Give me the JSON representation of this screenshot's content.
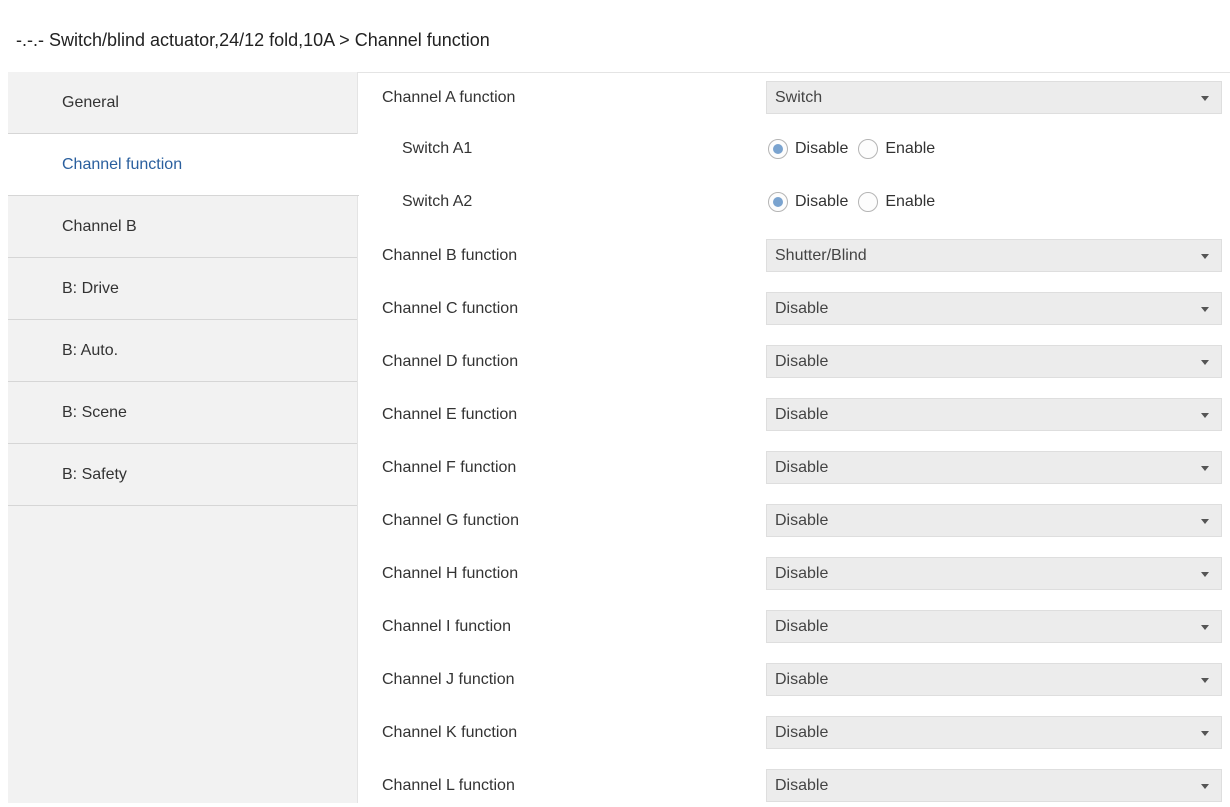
{
  "window": {
    "title": "-.-.- Switch/blind actuator,24/12 fold,10A > Channel function"
  },
  "sidebar": {
    "items": [
      {
        "label": "General",
        "active": false
      },
      {
        "label": "Channel function",
        "active": true
      },
      {
        "label": "Channel B",
        "active": false
      },
      {
        "label": "B: Drive",
        "active": false
      },
      {
        "label": "B: Auto.",
        "active": false
      },
      {
        "label": "B: Scene",
        "active": false
      },
      {
        "label": "B: Safety",
        "active": false
      }
    ]
  },
  "colors": {
    "active_nav_text": "#2a5f9e",
    "sidebar_bg": "#f2f2f2",
    "dropdown_bg": "#ececec",
    "radio_checked": "#7aa3cf"
  },
  "params": {
    "channel_a": {
      "label": "Channel A function",
      "value": "Switch"
    },
    "switch_a1": {
      "label": "Switch A1",
      "options": [
        "Disable",
        "Enable"
      ],
      "selected": "Disable"
    },
    "switch_a2": {
      "label": "Switch A2",
      "options": [
        "Disable",
        "Enable"
      ],
      "selected": "Disable"
    },
    "channel_b": {
      "label": "Channel B function",
      "value": "Shutter/Blind"
    },
    "channel_c": {
      "label": "Channel C function",
      "value": "Disable"
    },
    "channel_d": {
      "label": "Channel D function",
      "value": "Disable"
    },
    "channel_e": {
      "label": "Channel E function",
      "value": "Disable"
    },
    "channel_f": {
      "label": "Channel F function",
      "value": "Disable"
    },
    "channel_g": {
      "label": "Channel G function",
      "value": "Disable"
    },
    "channel_h": {
      "label": "Channel H function",
      "value": "Disable"
    },
    "channel_i": {
      "label": "Channel I function",
      "value": "Disable"
    },
    "channel_j": {
      "label": "Channel J function",
      "value": "Disable"
    },
    "channel_k": {
      "label": "Channel K function",
      "value": "Disable"
    },
    "channel_l": {
      "label": "Channel L function",
      "value": "Disable"
    }
  }
}
